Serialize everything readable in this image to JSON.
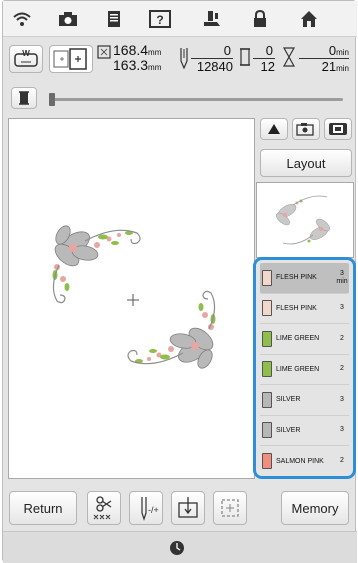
{
  "status": {
    "size_width": "168.4",
    "size_height": "163.3",
    "size_unit": "mm",
    "stitch_current": "0",
    "stitch_total": "12840",
    "color_current": "0",
    "color_total": "12",
    "time_current": "0",
    "time_total": "21",
    "time_unit": "min"
  },
  "buttons": {
    "layout": "Layout",
    "return": "Return",
    "memory": "Memory"
  },
  "thread_colors": [
    {
      "name": "FLESH PINK",
      "minutes": "3",
      "unit": "min",
      "color": "#f3d7c8",
      "selected": true
    },
    {
      "name": "FLESH PINK",
      "minutes": "3",
      "unit": "",
      "color": "#f3d7c8",
      "selected": false
    },
    {
      "name": "LIME GREEN",
      "minutes": "2",
      "unit": "",
      "color": "#8fbf4a",
      "selected": false
    },
    {
      "name": "LIME GREEN",
      "minutes": "2",
      "unit": "",
      "color": "#8fbf4a",
      "selected": false
    },
    {
      "name": "SILVER",
      "minutes": "3",
      "unit": "",
      "color": "#b7b7b7",
      "selected": false
    },
    {
      "name": "SILVER",
      "minutes": "3",
      "unit": "",
      "color": "#b7b7b7",
      "selected": false
    },
    {
      "name": "SALMON PINK",
      "minutes": "2",
      "unit": "",
      "color": "#f08f7f",
      "selected": false
    }
  ],
  "progress": 0.0,
  "colors": {
    "accent": "#2e8fd6"
  }
}
